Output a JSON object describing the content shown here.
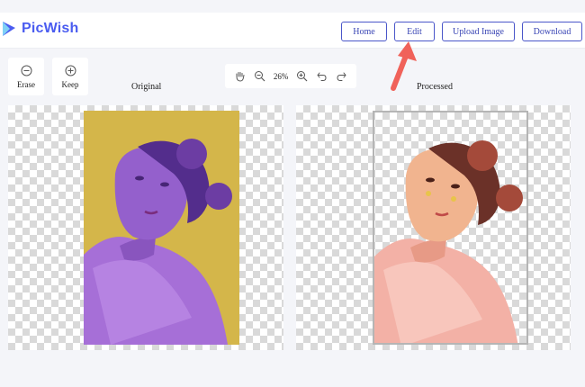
{
  "app": {
    "name": "PicWish",
    "brand_color": "#4a5cf0"
  },
  "nav": {
    "home": "Home",
    "edit": "Edit",
    "upload": "Upload Image",
    "download": "Download"
  },
  "tools": {
    "erase": "Erase",
    "keep": "Keep"
  },
  "zoom": {
    "level": "26%",
    "icons": [
      "hand-icon",
      "zoom-out-icon",
      "zoom-in-icon",
      "undo-icon",
      "redo-icon"
    ]
  },
  "panels": {
    "original_label": "Original",
    "processed_label": "Processed"
  },
  "colors": {
    "nav_border": "#4a56c9",
    "annotation_arrow": "#f0625a",
    "original_background": "#e8d12a"
  }
}
